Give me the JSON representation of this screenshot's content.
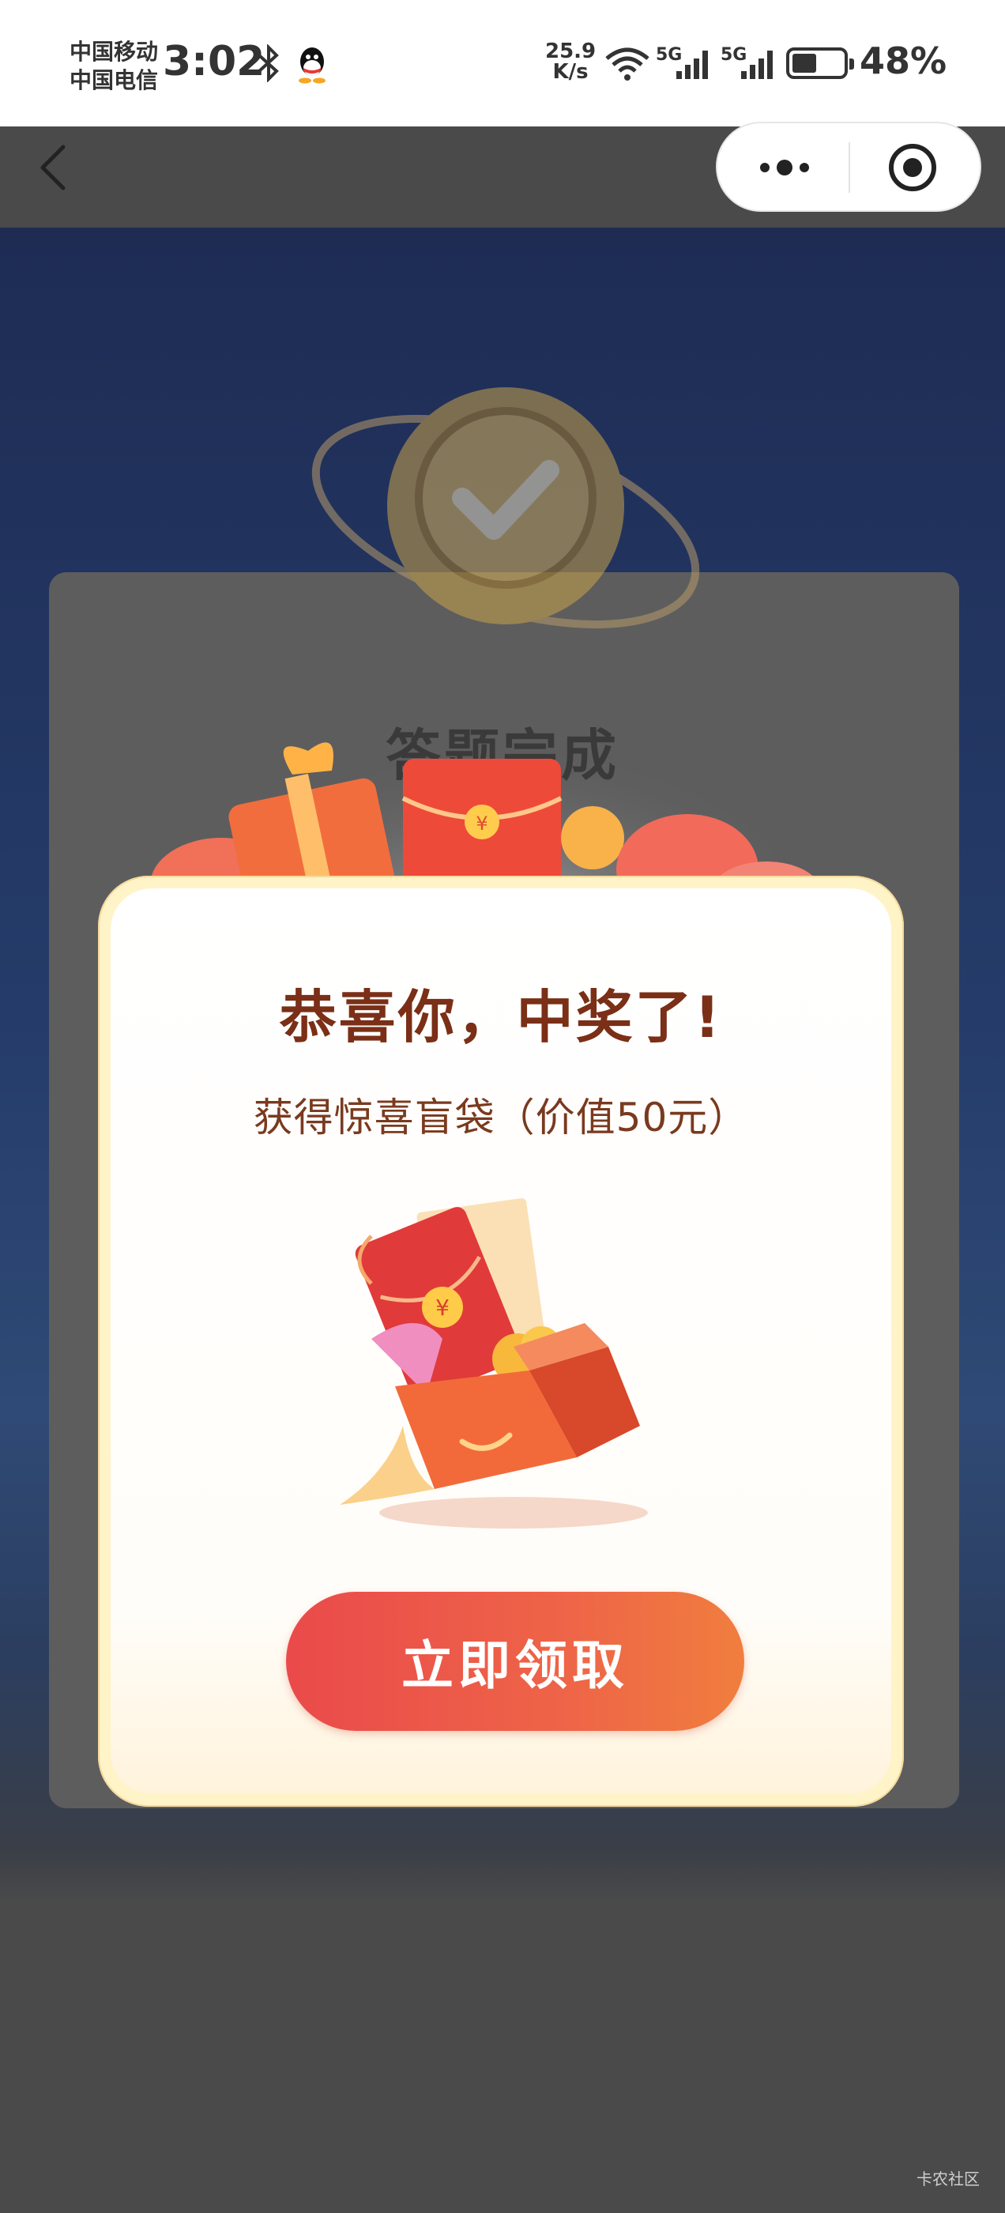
{
  "status_bar": {
    "carrier_top": "中国移动",
    "carrier_bottom": "中国电信",
    "time": "3:02",
    "net_speed_value": "25.9",
    "net_speed_unit": "K/s",
    "signal1_label": "5G",
    "signal2_label": "5G",
    "battery_percent": "48%",
    "icons": [
      "bluetooth-icon",
      "qq-icon",
      "wifi-icon",
      "signal-icon",
      "signal-icon",
      "battery-charging-icon"
    ]
  },
  "nav": {
    "back_icon": "chevron-left-icon",
    "more_icon": "more-dots-icon",
    "close_icon": "target-circle-icon"
  },
  "background": {
    "ghost_title": "答题完成"
  },
  "dialog": {
    "headline": "恭喜你，中奖了!",
    "subline": "获得惊喜盲袋（价值50元）",
    "prize_image": "gift-box-red-envelope-illustration",
    "claim_button": "立即领取"
  },
  "watermark": "卡农社区",
  "colors": {
    "accent_red": "#ea4a4a",
    "accent_orange": "#f07e3e",
    "headline_brown": "#7a2f16",
    "dialog_border": "#fff3c8",
    "background_navy": "#1e2c54"
  }
}
